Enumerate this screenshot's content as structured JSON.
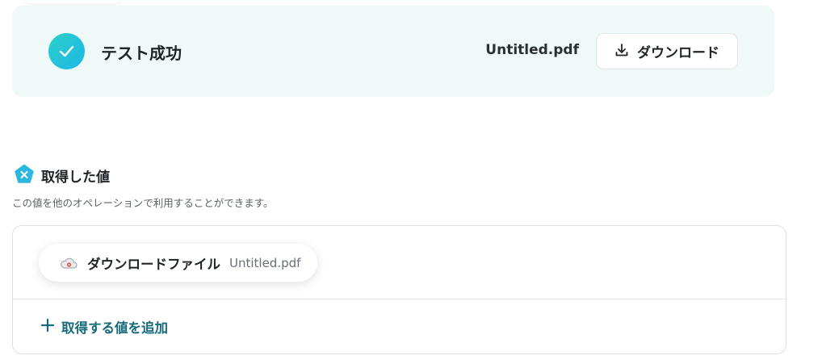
{
  "result": {
    "status_text": "テスト成功",
    "filename": "Untitled.pdf",
    "download_label": "ダウンロード"
  },
  "acquired": {
    "title": "取得した値",
    "description": "この値を他のオペレーションで利用することができます。",
    "items": [
      {
        "label": "ダウンロードファイル",
        "value": "Untitled.pdf"
      }
    ],
    "add_label": "取得する値を追加"
  },
  "colors": {
    "banner_bg": "#effaf8",
    "check_gradient_start": "#2ad0c8",
    "check_gradient_end": "#1fb7e6",
    "accent_text": "#176a7c",
    "section_icon": "#2bb7e0"
  },
  "icons": {
    "status": "check-icon",
    "download": "download-icon",
    "section": "variable-x-icon",
    "chip": "cloud-storage-icon",
    "add": "plus-icon"
  }
}
